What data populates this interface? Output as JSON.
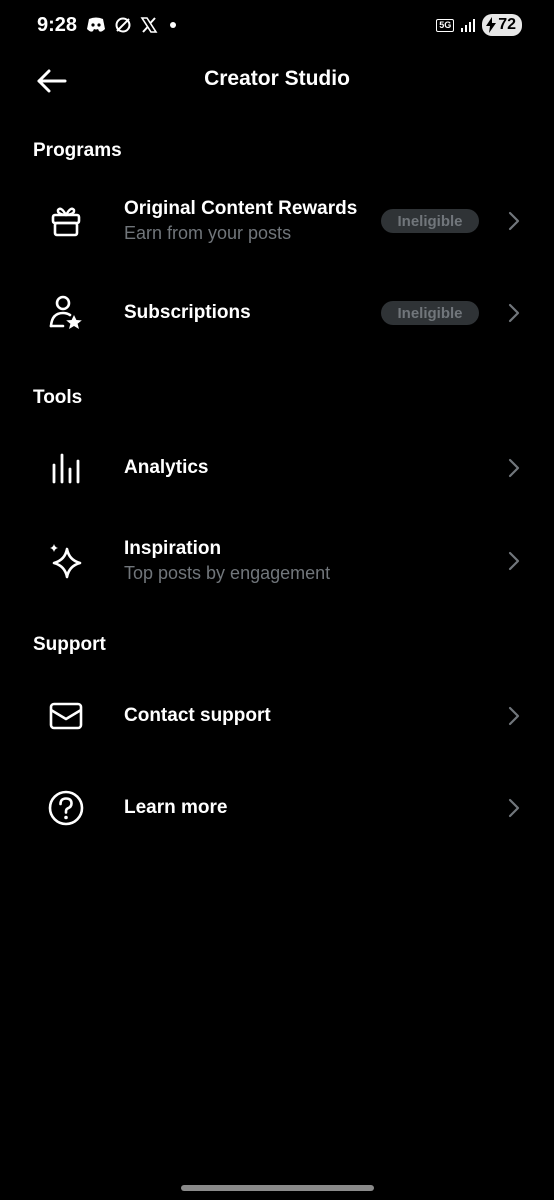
{
  "status_bar": {
    "time": "9:28",
    "network": "5G",
    "battery": "72"
  },
  "header": {
    "title": "Creator Studio"
  },
  "sections": {
    "programs": {
      "title": "Programs",
      "items": [
        {
          "label": "Original Content Rewards",
          "sub": "Earn from your posts",
          "badge": "Ineligible",
          "icon": "gift-icon"
        },
        {
          "label": "Subscriptions",
          "badge": "Ineligible",
          "icon": "user-star-icon"
        }
      ]
    },
    "tools": {
      "title": "Tools",
      "items": [
        {
          "label": "Analytics",
          "icon": "analytics-icon"
        },
        {
          "label": "Inspiration",
          "sub": "Top posts by engagement",
          "icon": "sparkle-icon"
        }
      ]
    },
    "support": {
      "title": "Support",
      "items": [
        {
          "label": "Contact support",
          "icon": "envelope-icon"
        },
        {
          "label": "Learn more",
          "icon": "help-circle-icon"
        }
      ]
    }
  },
  "colors": {
    "background": "#000000",
    "text_primary": "#ffffff",
    "text_secondary": "#71767b",
    "badge_bg": "#2f3336"
  }
}
